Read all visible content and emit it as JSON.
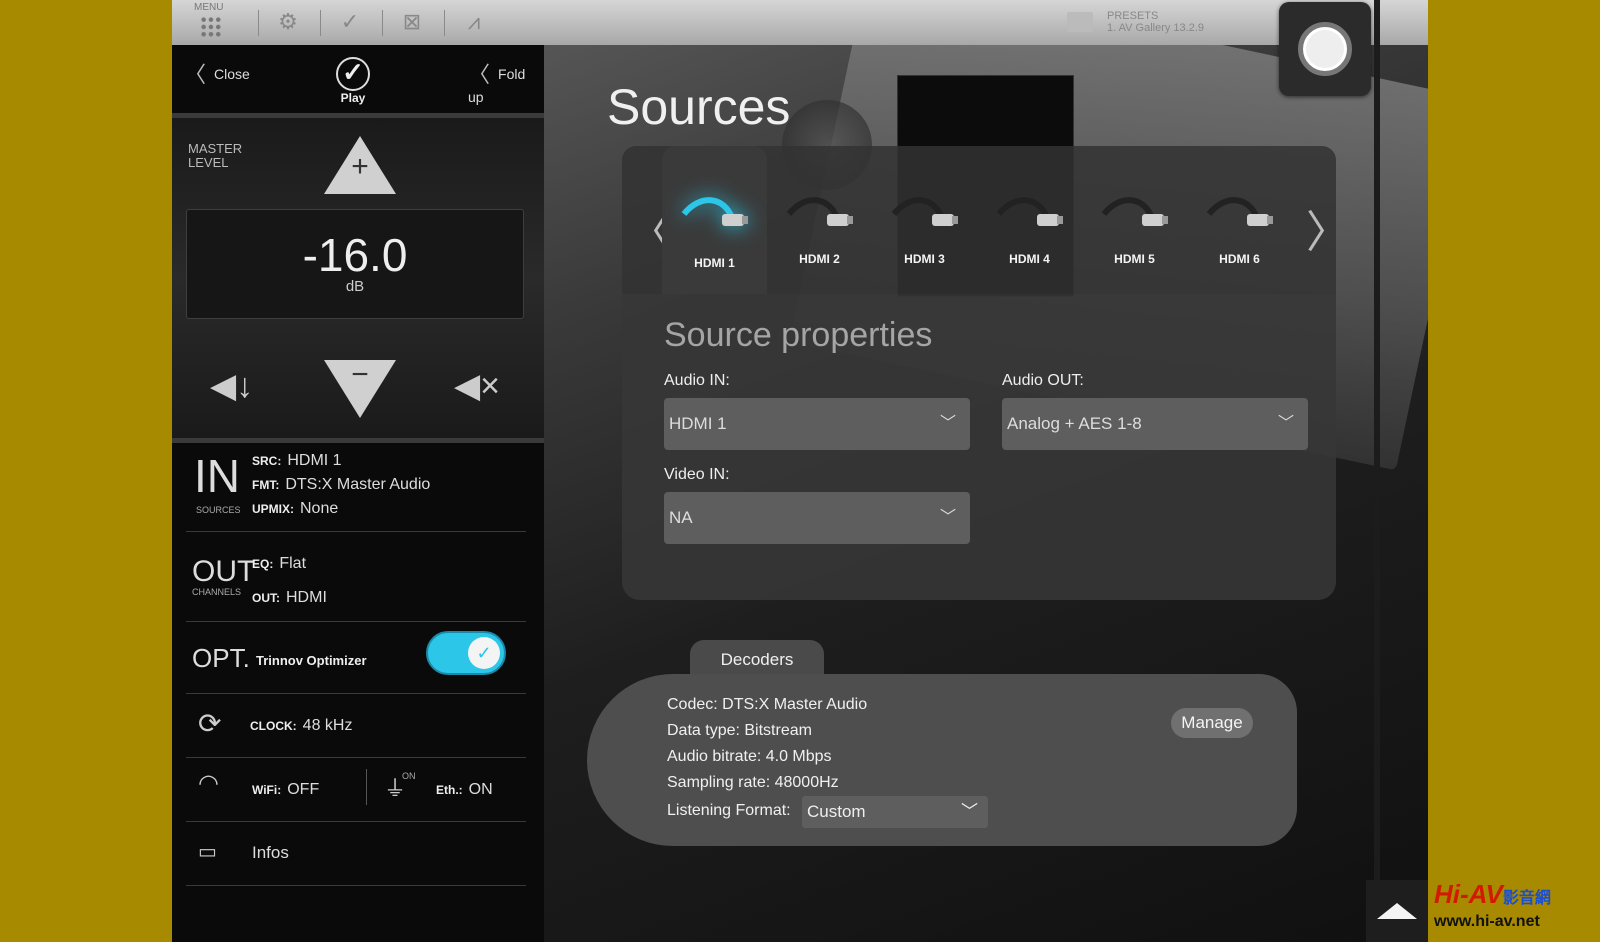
{
  "topbar": {
    "menu_label": "MENU",
    "presets_label": "PRESETS",
    "preset_name": "1. AV Gallery 13.2.9"
  },
  "left": {
    "close": "Close",
    "fold_up": "Fold up",
    "logo": "Play",
    "master_level_label": "MASTER\nLEVEL",
    "level_value": "-16.0",
    "level_unit": "dB",
    "in_big": "IN",
    "in_small": "SOURCES",
    "src_key": "SRC:",
    "src_val": "HDMI 1",
    "fmt_key": "FMT:",
    "fmt_val": "DTS:X Master Audio",
    "upmix_key": "UPMIX:",
    "upmix_val": "None",
    "out_big": "OUT",
    "out_small": "CHANNELS",
    "eq_key": "EQ:",
    "eq_val": "Flat",
    "out_key": "OUT:",
    "out_val": "HDMI",
    "opt_big": "OPT.",
    "opt_label": "Trinnov Optimizer",
    "clock_key": "CLOCK:",
    "clock_val": "48 kHz",
    "wifi_key": "WiFi:",
    "wifi_val": "OFF",
    "on_small": "ON",
    "eth_key": "Eth.:",
    "eth_val": "ON",
    "infos": "Infos"
  },
  "main": {
    "title": "Sources",
    "sources": [
      "HDMI 1",
      "HDMI 2",
      "HDMI 3",
      "HDMI 4",
      "HDMI 5",
      "HDMI 6"
    ],
    "selected_source": "HDMI 1",
    "props_title": "Source properties",
    "audio_in_label": "Audio IN:",
    "audio_in_value": "HDMI 1",
    "audio_out_label": "Audio OUT:",
    "audio_out_value": "Analog + AES 1-8",
    "video_in_label": "Video IN:",
    "video_in_value": "NA",
    "decoders_tab": "Decoders",
    "codec": "Codec: DTS:X Master Audio",
    "data_type": "Data type: Bitstream",
    "bitrate": "Audio bitrate: 4.0 Mbps",
    "sampling": "Sampling rate: 48000Hz",
    "listening_label": "Listening Format:",
    "listening_value": "Custom",
    "manage": "Manage"
  },
  "watermark": {
    "logo": "Hi-AV",
    "logo_cn": "影音網",
    "url": "www.hi-av.net"
  },
  "colors": {
    "accent": "#2cc6e8",
    "border_bg": "#a88a00"
  }
}
